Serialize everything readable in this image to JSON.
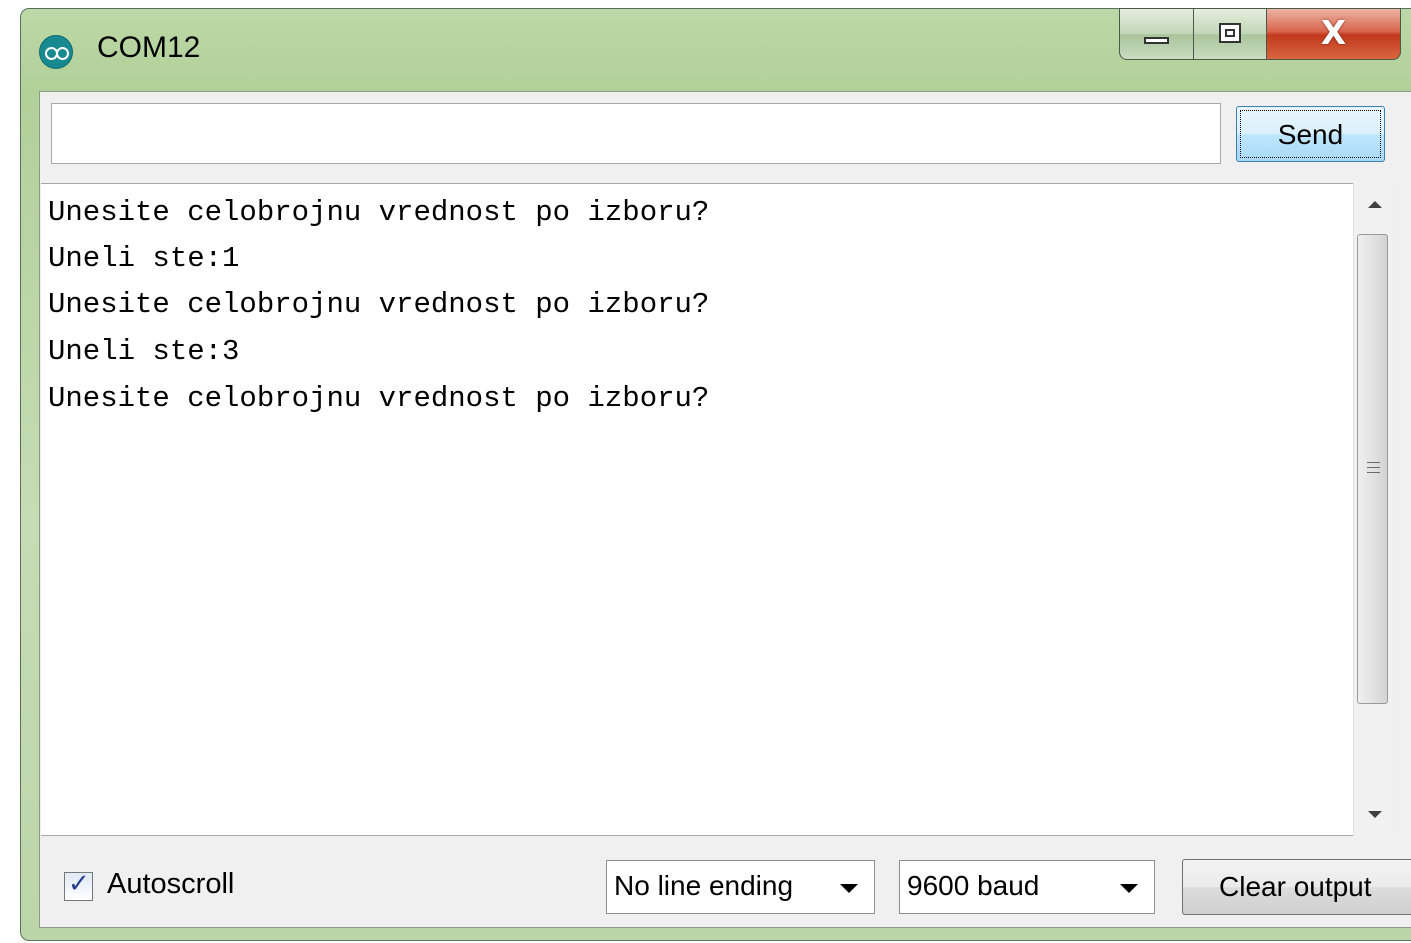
{
  "window": {
    "title": "COM12",
    "icon": "arduino-icon",
    "controls": {
      "minimize": "minimize-icon",
      "maximize": "maximize-icon",
      "close_label": "X"
    }
  },
  "send_bar": {
    "input_value": "",
    "send_label": "Send"
  },
  "output": {
    "lines": [
      "Unesite celobrojnu vrednost po izboru?",
      "Uneli ste:1",
      "Unesite celobrojnu vrednost po izboru?",
      "Uneli ste:3",
      "Unesite celobrojnu vrednost po izboru?"
    ]
  },
  "scrollbar": {
    "grip_icon": "scroll-grip-icon"
  },
  "footer": {
    "autoscroll_label": "Autoscroll",
    "autoscroll_checked": true,
    "line_ending": "No line ending",
    "baud_rate": "9600 baud",
    "clear_label": "Clear output"
  }
}
